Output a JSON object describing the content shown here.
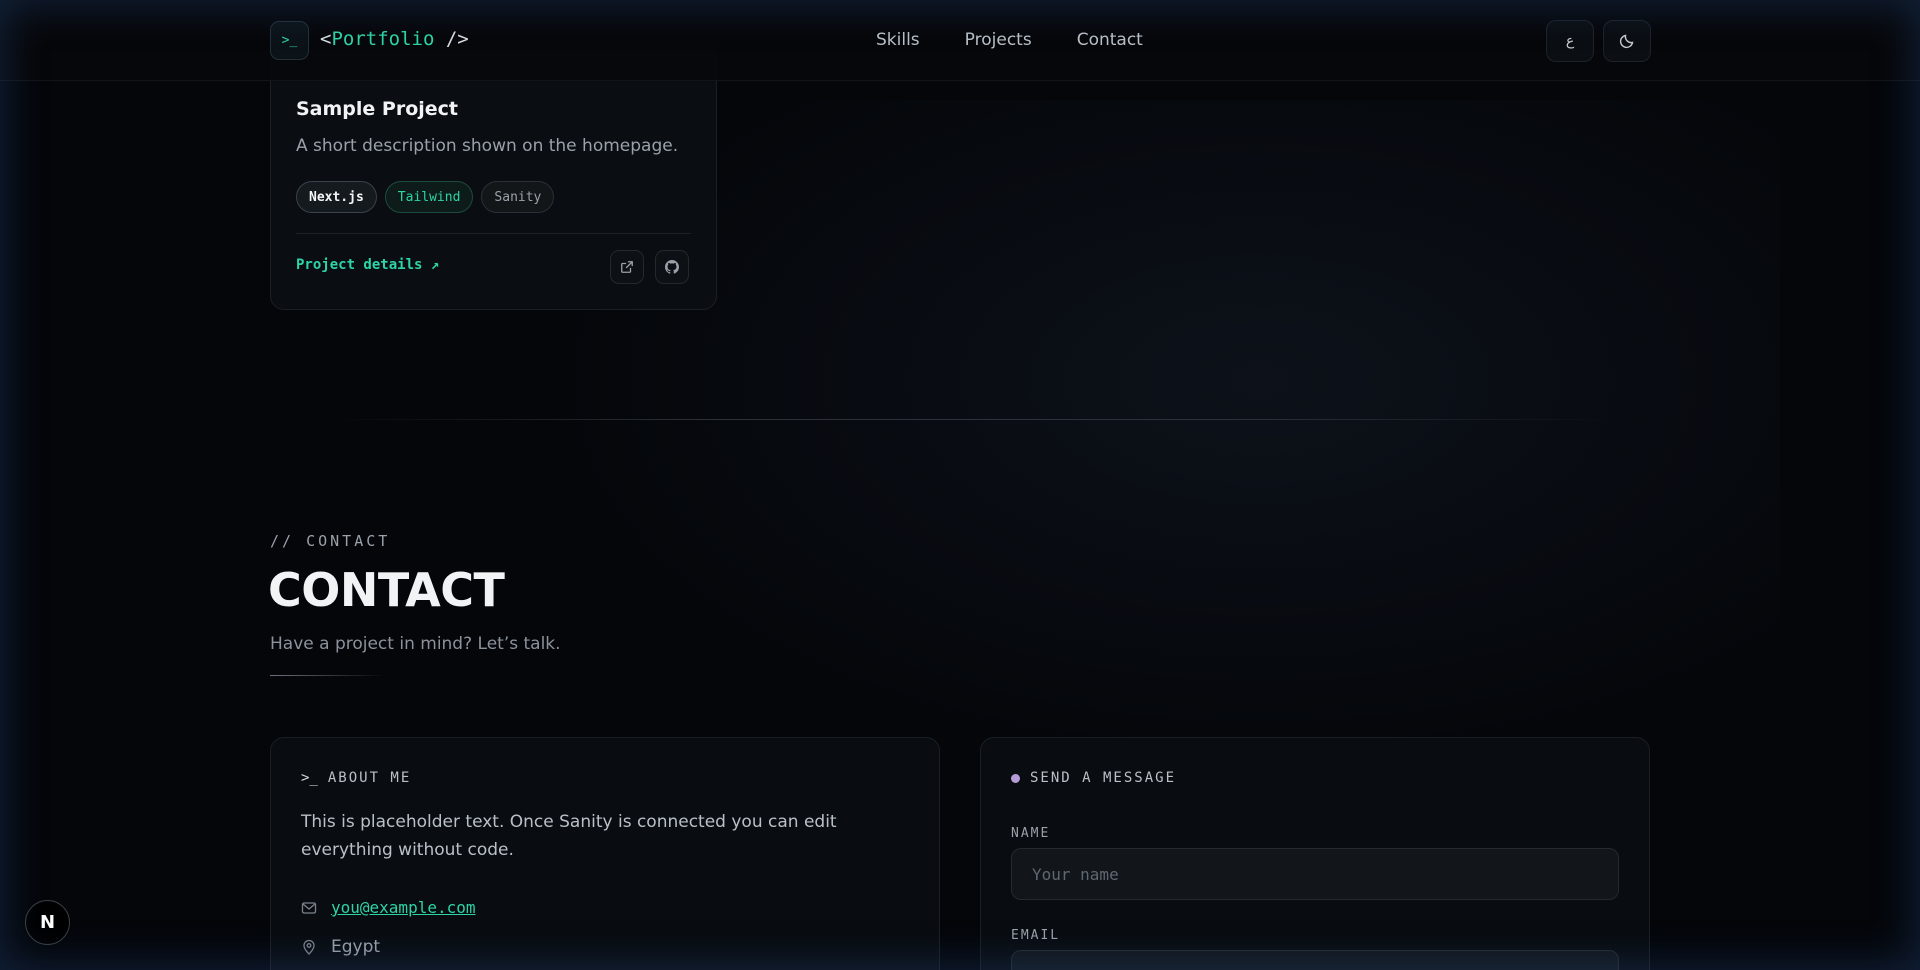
{
  "nav": {
    "logo_prompt": ">_",
    "logo_open": "<",
    "logo_name": "Portfolio",
    "logo_close": " />",
    "links": [
      {
        "label": "Skills"
      },
      {
        "label": "Projects"
      },
      {
        "label": "Contact"
      }
    ],
    "lang_button": "ع"
  },
  "project": {
    "title": "Sample Project",
    "description": "A short description shown on the homepage.",
    "tags": [
      "Next.js",
      "Tailwind",
      "Sanity"
    ],
    "details_link": "Project details ↗"
  },
  "contact": {
    "eyebrow": "// CONTACT",
    "heading": "CONTACT",
    "subtitle": "Have a project in mind? Let’s talk.",
    "about": {
      "prompt": ">_",
      "label": "ABOUT ME",
      "text": "This is placeholder text. Once Sanity is connected you can edit everything without code.",
      "email": "you@example.com",
      "location": "Egypt"
    },
    "form": {
      "label": "SEND A MESSAGE",
      "name_label": "NAME",
      "name_placeholder": "Your name",
      "email_label": "EMAIL"
    }
  },
  "badge": "N",
  "colors": {
    "accent": "#2dd4a6",
    "background": "#04060a",
    "dot": "#b69bd6"
  }
}
